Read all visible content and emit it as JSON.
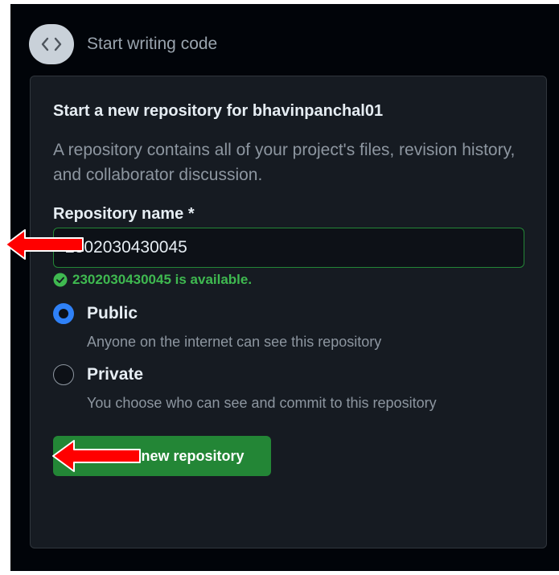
{
  "step": {
    "title": "Start writing code",
    "icon": "code-icon"
  },
  "card": {
    "title": "Start a new repository for bhavinpanchal01",
    "description": "A repository contains all of your project's files, revision history, and collaborator discussion."
  },
  "repo_name": {
    "label": "Repository name *",
    "value": "2302030430045",
    "available_message": "2302030430045 is available."
  },
  "visibility": {
    "selected": "public",
    "options": [
      {
        "label": "Public",
        "description": "Anyone on the internet can see this repository"
      },
      {
        "label": "Private",
        "description": "You choose who can see and commit to this repository"
      }
    ]
  },
  "create_button": {
    "label": "Create a new repository"
  },
  "colors": {
    "accent_green": "#238636",
    "success_text": "#3fb950",
    "radio_blue": "#2f81f7",
    "annotation_arrow": "#ff0000"
  }
}
